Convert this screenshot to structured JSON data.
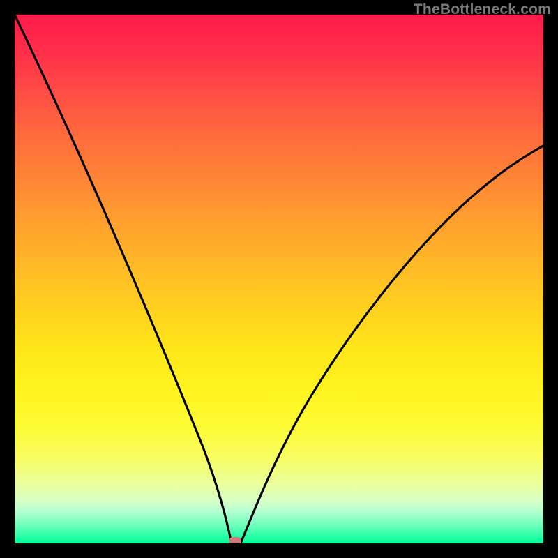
{
  "watermark": "TheBottleneck.com",
  "chart_data": {
    "type": "line",
    "title": "",
    "xlabel": "",
    "ylabel": "",
    "xlim": [
      0,
      100
    ],
    "ylim": [
      0,
      100
    ],
    "grid": false,
    "legend": false,
    "annotations": [
      {
        "type": "marker",
        "shape": "rounded-rect",
        "x": 41,
        "y": 0,
        "color": "#c97a7a"
      }
    ],
    "series": [
      {
        "name": "bottleneck-curve-left",
        "color": "#000000",
        "x": [
          0,
          4,
          8,
          12,
          16,
          20,
          24,
          28,
          32,
          35,
          37,
          38.5,
          39.5,
          40.3,
          41
        ],
        "y": [
          100,
          92,
          84,
          76,
          67,
          59,
          50,
          41,
          31,
          21,
          13,
          8,
          4,
          1.5,
          0
        ]
      },
      {
        "name": "bottleneck-curve-right",
        "color": "#000000",
        "x": [
          41,
          42,
          44,
          47,
          50,
          54,
          58,
          63,
          68,
          74,
          80,
          86,
          92,
          97,
          100
        ],
        "y": [
          0,
          1,
          3.5,
          7.5,
          12,
          18,
          24,
          31,
          38,
          46,
          53,
          60,
          67,
          72,
          75
        ]
      }
    ]
  }
}
